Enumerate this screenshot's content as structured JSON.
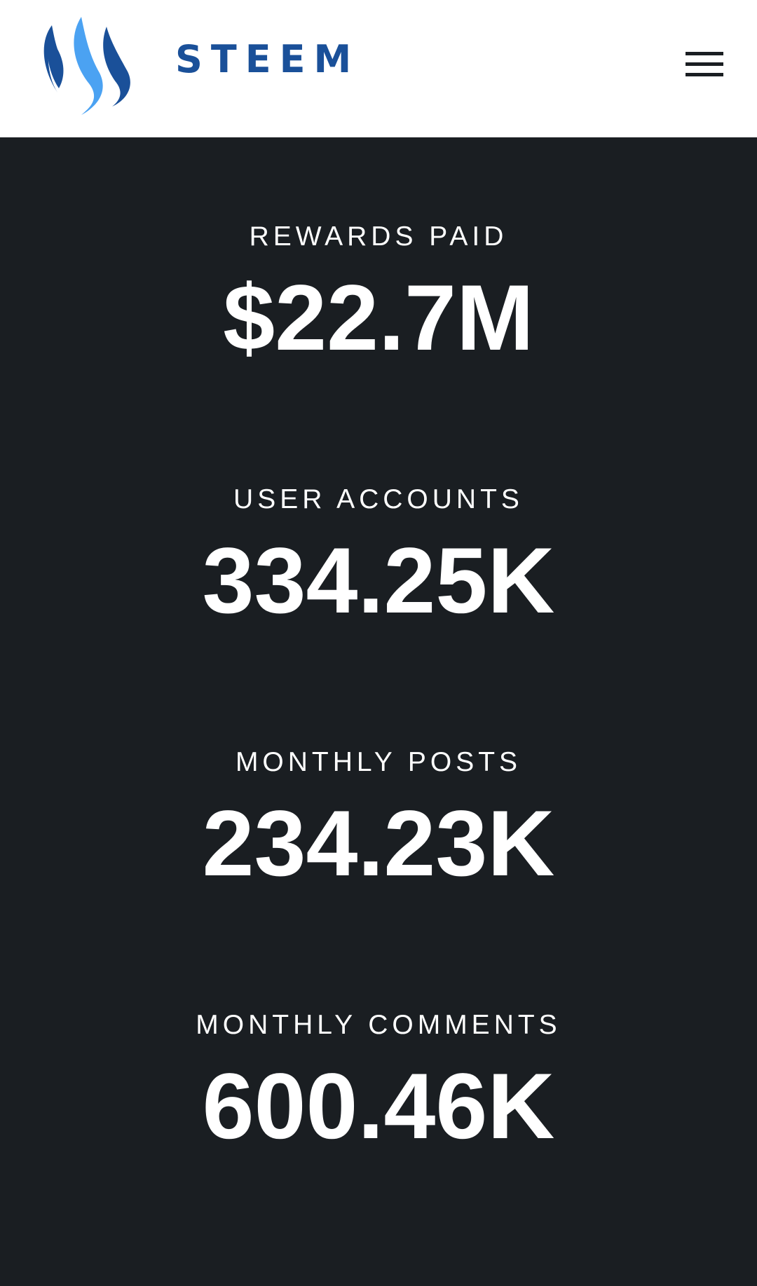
{
  "header": {
    "brand_name": "STEEM",
    "logo_icon": "steem-logo-icon",
    "menu_icon": "hamburger-menu-icon",
    "colors": {
      "brand_dark_blue": "#1a5099",
      "brand_light_blue": "#4ba2f2",
      "background": "#ffffff"
    }
  },
  "stats": [
    {
      "label": "REWARDS PAID",
      "value": "$22.7M"
    },
    {
      "label": "USER ACCOUNTS",
      "value": "334.25K"
    },
    {
      "label": "MONTHLY POSTS",
      "value": "234.23K"
    },
    {
      "label": "MONTHLY COMMENTS",
      "value": "600.46K"
    }
  ],
  "colors": {
    "main_background": "#1a1e22",
    "text": "#ffffff"
  }
}
